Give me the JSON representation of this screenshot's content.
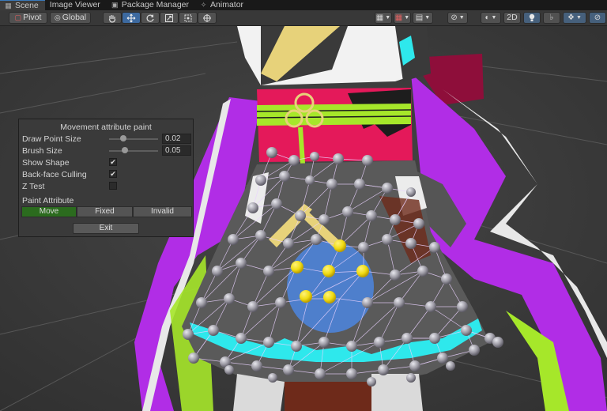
{
  "tabs": [
    {
      "label": "Scene",
      "icon": "scene-icon",
      "active": true
    },
    {
      "label": "Image Viewer",
      "icon": "",
      "active": false
    },
    {
      "label": "Package Manager",
      "icon": "package-icon",
      "active": false
    },
    {
      "label": "Animator",
      "icon": "animator-icon",
      "active": false
    }
  ],
  "toolbar": {
    "pivot_label": "Pivot",
    "global_label": "Global",
    "mode_2d_label": "2D"
  },
  "panel": {
    "title": "Movement attribute paint",
    "draw_point_size": {
      "label": "Draw Point Size",
      "value": "0.02",
      "slider_fraction": 0.25
    },
    "brush_size": {
      "label": "Brush Size",
      "value": "0.05",
      "slider_fraction": 0.3
    },
    "show_shape": {
      "label": "Show Shape",
      "checked": true
    },
    "backface_culling": {
      "label": "Back-face Culling",
      "checked": true
    },
    "z_test": {
      "label": "Z Test",
      "checked": false
    },
    "paint_attribute_label": "Paint Attribute",
    "attributes": [
      "Move",
      "Fixed",
      "Invalid"
    ],
    "selected_attribute": "Move",
    "exit_label": "Exit"
  },
  "colors": {
    "selected_green": "#2b6b1e",
    "magenta": "#b12de6",
    "cyan": "#2ee8ec",
    "yellow_point": "#f0dc14",
    "lime": "#a6e72a",
    "crimson": "#e4195a",
    "brush_blue": "#4c86e0"
  }
}
